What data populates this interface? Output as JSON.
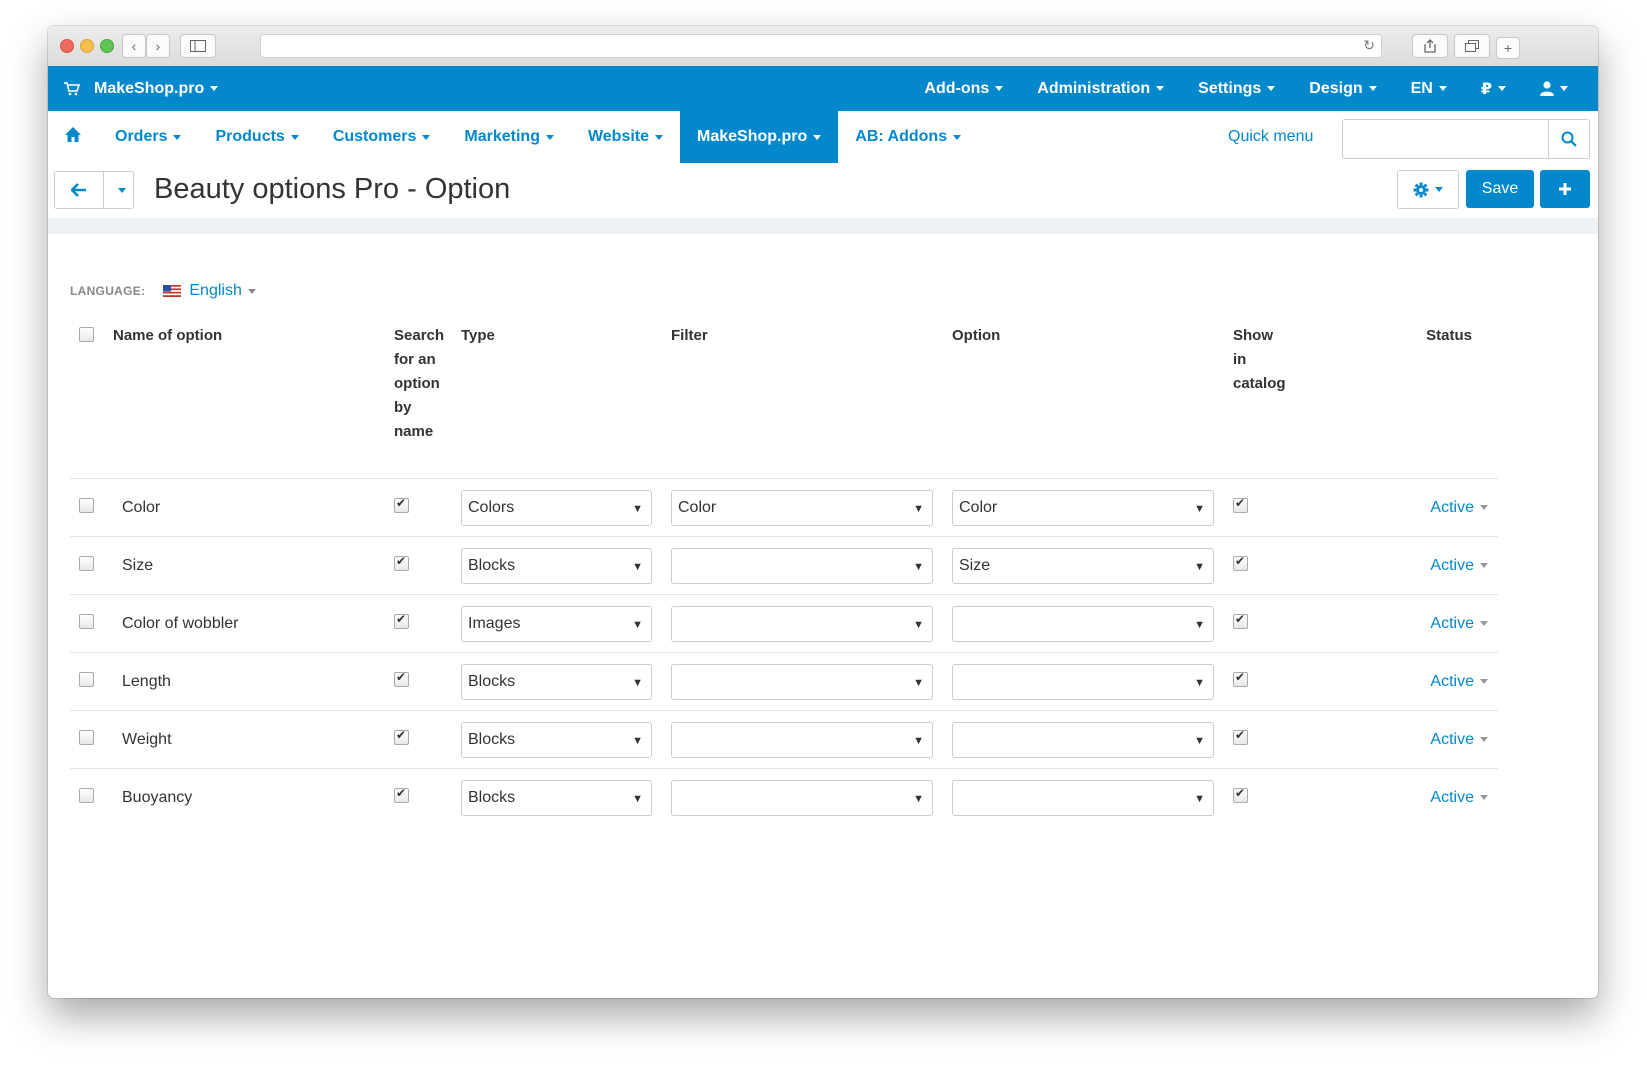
{
  "browser": {},
  "topbar": {
    "brand": "MakeShop.pro",
    "menu": [
      "Add-ons",
      "Administration",
      "Settings",
      "Design",
      "EN",
      "₽"
    ]
  },
  "secnav": {
    "items": [
      "Orders",
      "Products",
      "Customers",
      "Marketing",
      "Website",
      "MakeShop.pro",
      "AB: Addons"
    ],
    "active_index": 5,
    "quick_menu": "Quick menu",
    "search_value": ""
  },
  "titlebar": {
    "title": "Beauty options Pro - Option",
    "save_label": "Save"
  },
  "language": {
    "label": "LANGUAGE:",
    "value": "English"
  },
  "table": {
    "headers": {
      "name": "Name of option",
      "search": "Search for an option by name",
      "type": "Type",
      "filter": "Filter",
      "option": "Option",
      "show": "Show in catalog",
      "status": "Status"
    },
    "rows": [
      {
        "name": "Color",
        "search": true,
        "type": "Colors",
        "filter": "Color",
        "option": "Color",
        "show": true,
        "status": "Active"
      },
      {
        "name": "Size",
        "search": true,
        "type": "Blocks",
        "filter": "",
        "option": "Size",
        "show": true,
        "status": "Active"
      },
      {
        "name": "Color of wobbler",
        "search": true,
        "type": "Images",
        "filter": "",
        "option": "",
        "show": true,
        "status": "Active"
      },
      {
        "name": "Length",
        "search": true,
        "type": "Blocks",
        "filter": "",
        "option": "",
        "show": true,
        "status": "Active"
      },
      {
        "name": "Weight",
        "search": true,
        "type": "Blocks",
        "filter": "",
        "option": "",
        "show": true,
        "status": "Active"
      },
      {
        "name": "Buoyancy",
        "search": true,
        "type": "Blocks",
        "filter": "",
        "option": "",
        "show": true,
        "status": "Active"
      }
    ]
  },
  "colors": {
    "accent": "#0388cc",
    "text": "#333333",
    "muted": "#888888"
  }
}
